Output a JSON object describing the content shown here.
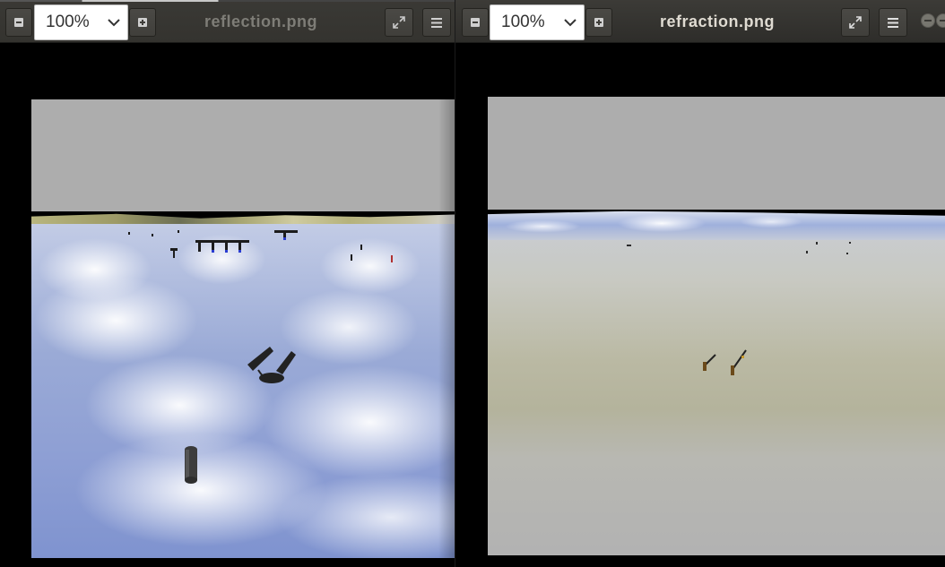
{
  "left_window": {
    "title": "reflection.png",
    "zoom": "100%"
  },
  "right_window": {
    "title": "refraction.png",
    "zoom": "100%"
  },
  "colors": {
    "headerbar": "#3c3b37",
    "title_inactive": "#7e7d77",
    "title_active": "#dfdbd2",
    "viewer_background": "#000000",
    "canvas_gray": "#adadad"
  },
  "icons": {
    "zoom_out": "minus-box-icon",
    "zoom_in": "plus-box-icon",
    "zoom_dropdown": "chevron-down-icon",
    "fullscreen": "expand-arrows-icon",
    "menu": "hamburger-icon",
    "minimize": "minimize-circle-icon"
  }
}
